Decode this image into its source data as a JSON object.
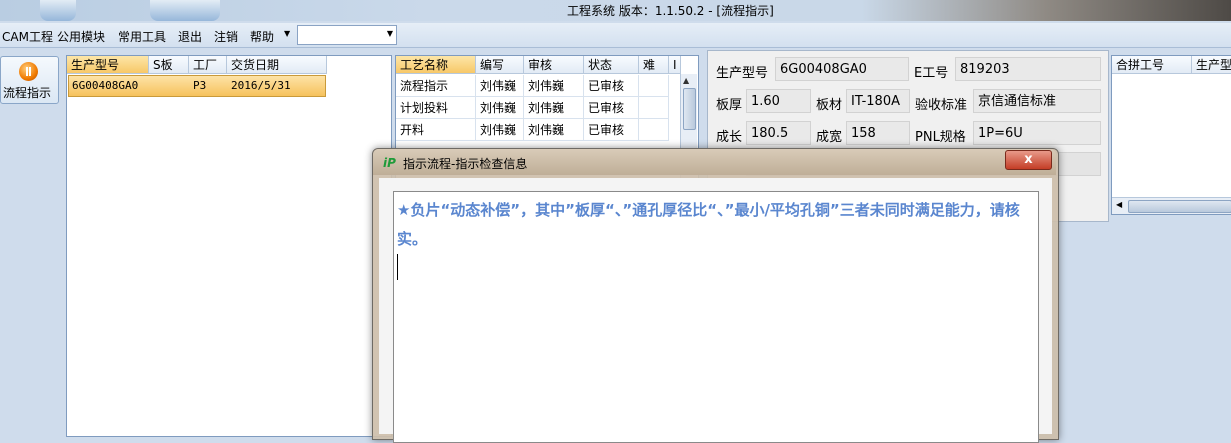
{
  "window": {
    "title": "工程系统   版本：1.1.50.2 - [流程指示]"
  },
  "menu": {
    "items": [
      "CAM工程",
      "公用模块",
      "常用工具",
      "退出",
      "注销",
      "帮助"
    ],
    "combo_value": ""
  },
  "nav": {
    "button_label": "流程指示",
    "icon": "power-icon"
  },
  "orders": {
    "headers": [
      "生产型号",
      "S板",
      "工厂",
      "交货日期"
    ],
    "rows": [
      {
        "model": "6G00408GA0",
        "s": "",
        "factory": "P3",
        "date": "2016/5/31"
      }
    ]
  },
  "process": {
    "headers": [
      "工艺名称",
      "编写",
      "审核",
      "状态",
      "难",
      "I"
    ],
    "rows": [
      {
        "name": "流程指示",
        "author": "刘伟巍",
        "reviewer": "刘伟巍",
        "status": "已审核"
      },
      {
        "name": "计划投料",
        "author": "刘伟巍",
        "reviewer": "刘伟巍",
        "status": "已审核"
      },
      {
        "name": "开料",
        "author": "刘伟巍",
        "reviewer": "刘伟巍",
        "status": "已审核"
      }
    ]
  },
  "info": {
    "model_label": "生产型号",
    "model": "6G00408GA0",
    "eno_label": "E工号",
    "eno": "819203",
    "thick_label": "板厚",
    "thick": "1.60",
    "material_label": "板材",
    "material": "IT-180A",
    "std_label": "验收标准",
    "std": "京信通信标准",
    "len_label": "成长",
    "len": "180.5",
    "wid_label": "成宽",
    "wid": "158",
    "pnl_label": "PNL规格",
    "pnl": "1P=6U"
  },
  "merge": {
    "headers": [
      "合拼工号",
      "生产型"
    ]
  },
  "dialog": {
    "title": "指示流程-指示检查信息",
    "close": "x",
    "message": "★负片“动态补偿”，其中”板厚“、”通孔厚径比“、”最小/平均孔铜”三者未同时满足能力，请核实。"
  },
  "colors": {
    "message": "#5a86cf",
    "selected_row": "#f6c25d"
  }
}
